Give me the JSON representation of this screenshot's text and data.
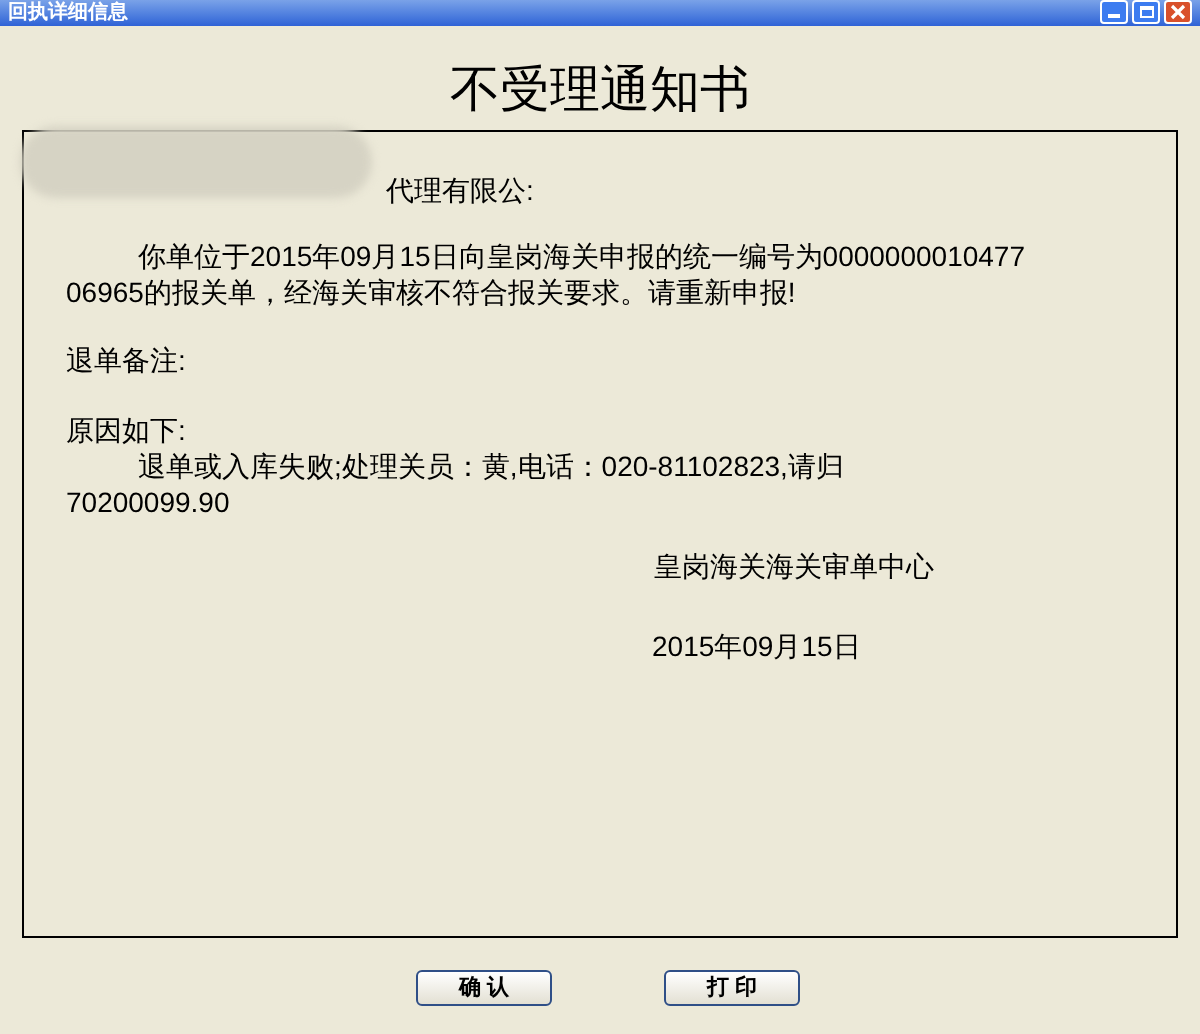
{
  "window": {
    "title": "回执详细信息"
  },
  "heading": "不受理通知书",
  "letter": {
    "addressee": "代理有限公:",
    "body": "你单位于2015年09月15日向皇岗海关申报的统一编号为000000001047706965的报关单，经海关审核不符合报关要求。请重新申报!",
    "remarks_label": "退单备注:",
    "reason_label": "原因如下:",
    "reason": "退单或入库失败;处理关员：黄,电话：020-81102823,请归70200099.90",
    "signature": "皇岗海关海关审单中心",
    "date": "2015年09月15日"
  },
  "buttons": [
    "确 认",
    "打 印"
  ]
}
